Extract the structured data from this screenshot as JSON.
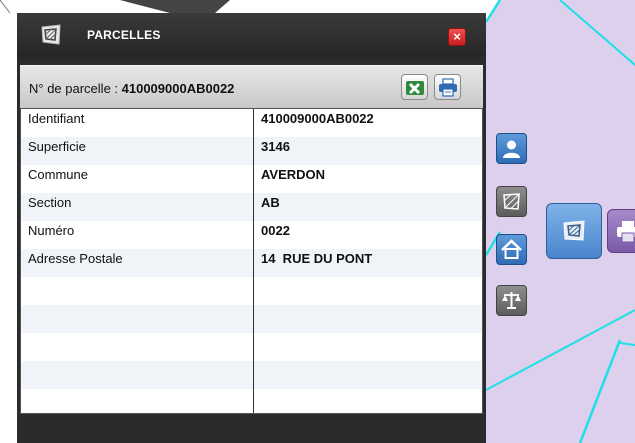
{
  "panel": {
    "title": "PARCELLES",
    "close_label": "×",
    "parcel_prefix": "N° de parcelle : ",
    "parcel_number": "410009000AB0022",
    "excel_icon": "excel-icon",
    "print_icon": "printer-icon"
  },
  "rows": [
    {
      "key": "Identifiant",
      "value": "410009000AB0022"
    },
    {
      "key": "Superficie",
      "value": "3146"
    },
    {
      "key": "Commune",
      "value": "AVERDON"
    },
    {
      "key": "Section",
      "value": "AB"
    },
    {
      "key": "Numéro",
      "value": "0022"
    },
    {
      "key": "Adresse Postale",
      "value": "14  RUE DU PONT"
    },
    {
      "key": "",
      "value": ""
    },
    {
      "key": "",
      "value": ""
    },
    {
      "key": "",
      "value": ""
    },
    {
      "key": "",
      "value": ""
    },
    {
      "key": "",
      "value": ""
    }
  ],
  "toolbar": {
    "items": [
      "user-icon",
      "parcel-icon",
      "home-icon",
      "scales-icon"
    ],
    "floating": [
      "parcel-icon",
      "printer-icon"
    ]
  },
  "colors": {
    "map_purple": "#dcd0ec",
    "map_line": "#1ee0e6",
    "accent_blue": "#3d7cc9"
  }
}
